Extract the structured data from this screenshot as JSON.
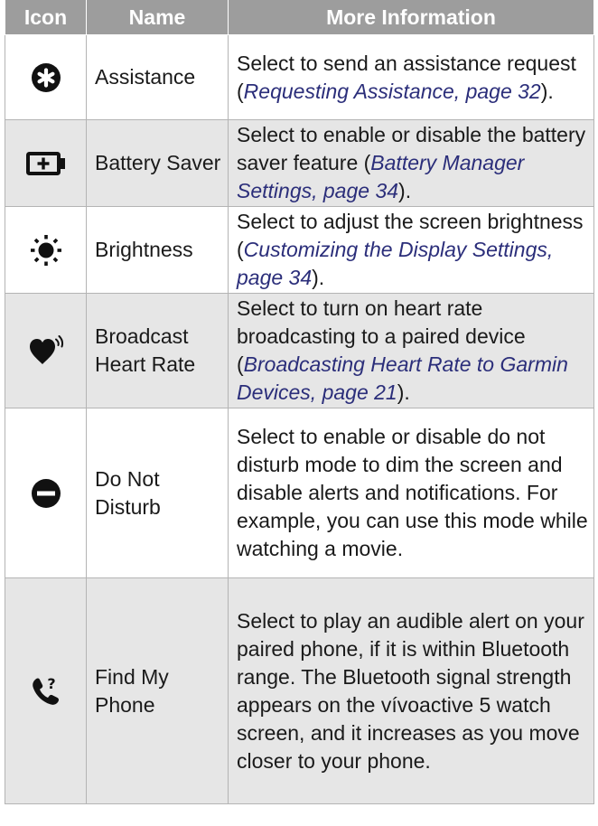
{
  "table": {
    "headers": [
      "Icon",
      "Name",
      "More Information"
    ],
    "rows": [
      {
        "icon": "assistance-icon",
        "name": "Assistance",
        "info_before": "Select to send an assistance request (",
        "info_ref": "Requesting Assistance, page 32",
        "info_after": ")."
      },
      {
        "icon": "battery-saver-icon",
        "name": "Battery Saver",
        "info_before": "Select to enable or disable the battery saver feature (",
        "info_ref": "Battery Manager Settings, page 34",
        "info_after": ")."
      },
      {
        "icon": "brightness-icon",
        "name": "Brightness",
        "info_before": "Select to adjust the screen brightness (",
        "info_ref": "Customizing the Display Settings, page 34",
        "info_after": ")."
      },
      {
        "icon": "broadcast-heart-rate-icon",
        "name": "Broadcast Heart Rate",
        "info_before": "Select to turn on heart rate broadcasting to a paired device (",
        "info_ref": "Broadcasting Heart Rate to Garmin Devices, page 21",
        "info_after": ")."
      },
      {
        "icon": "do-not-disturb-icon",
        "name": "Do Not Disturb",
        "info_before": "Select to enable or disable do not disturb mode to dim the screen and disable alerts and notifications. For example, you can use this mode while watching a movie."
      },
      {
        "icon": "find-my-phone-icon",
        "name": "Find My Phone",
        "info_before": "Select to play an audible alert on your paired phone, if it is within Bluetooth range. The Bluetooth signal strength appears on the vívoactive 5 watch screen, and it increases as you move closer to your phone."
      }
    ]
  }
}
